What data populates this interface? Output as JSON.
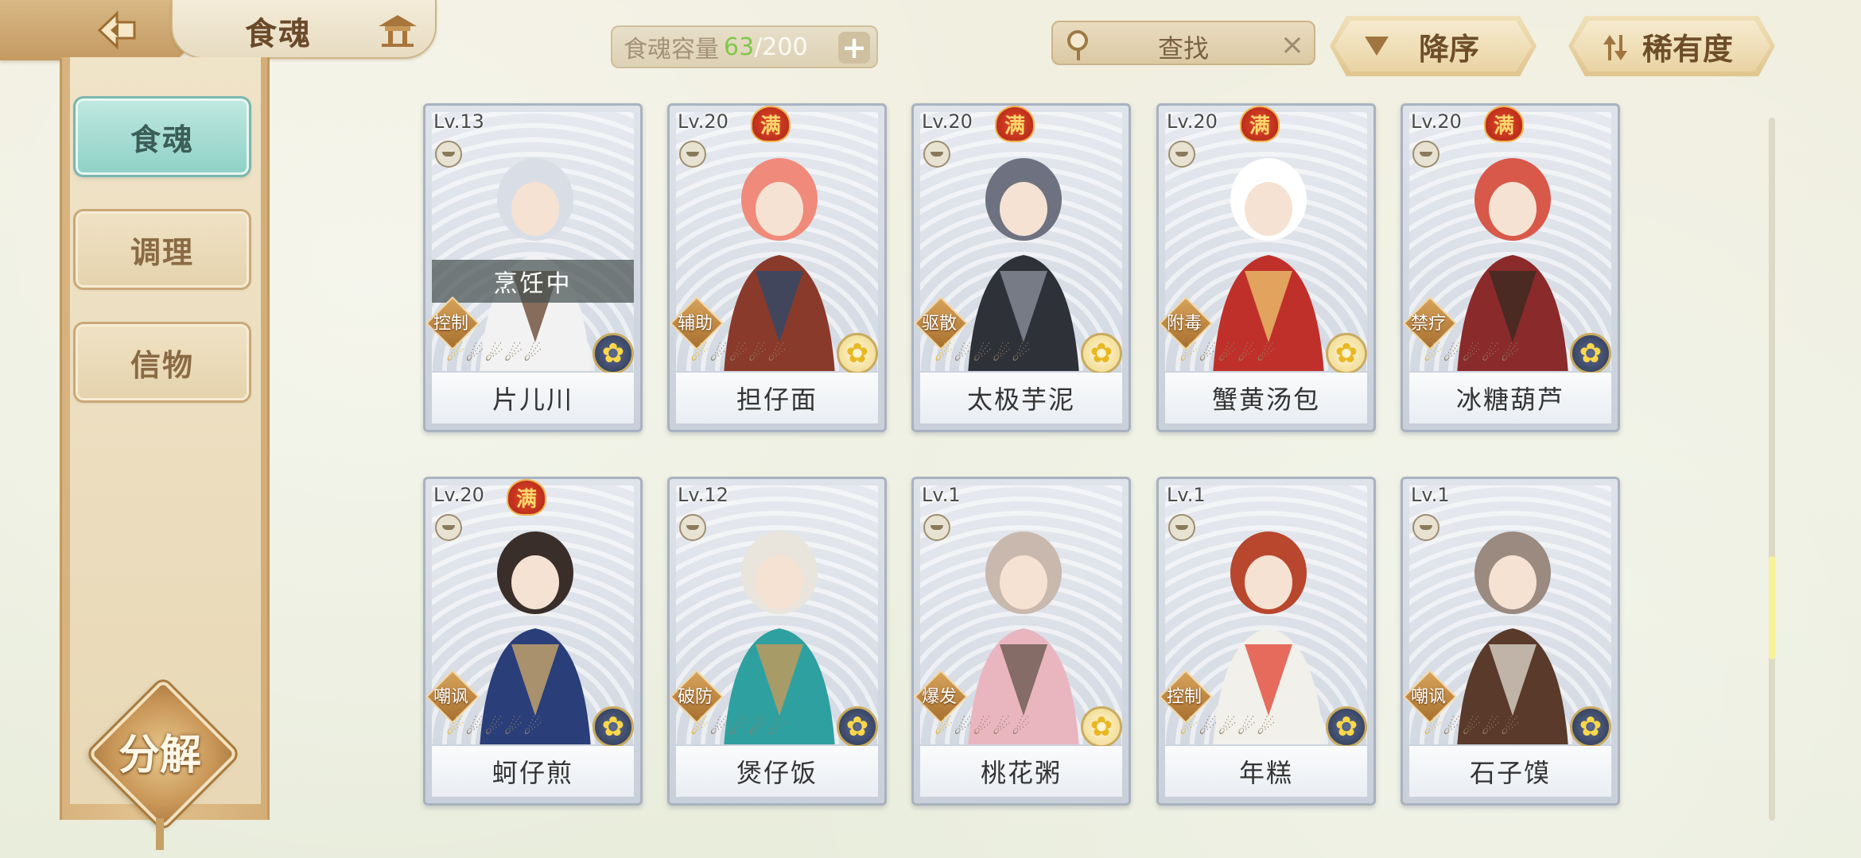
{
  "header": {
    "title": "食魂",
    "back": "back-arrow-icon",
    "home": "pavilion-icon"
  },
  "sidebar": {
    "tabs": [
      {
        "label": "食魂",
        "active": true
      },
      {
        "label": "调理",
        "active": false
      },
      {
        "label": "信物",
        "active": false
      }
    ],
    "decompose_label": "分解"
  },
  "capacity": {
    "label": "食魂容量",
    "current": "63",
    "max": "/200",
    "plus": "+"
  },
  "search": {
    "placeholder": "查找",
    "clear": "×"
  },
  "sort": {
    "order_label": "降序",
    "rarity_label": "稀有度"
  },
  "cards": [
    {
      "level": "Lv.13",
      "full": "",
      "role": "控制",
      "stars": 1,
      "element": "dark",
      "name": "片儿川",
      "status": "烹饪中"
    },
    {
      "level": "Lv.20",
      "full": "满",
      "role": "辅助",
      "stars": 1,
      "element": "gold",
      "name": "担仔面",
      "status": ""
    },
    {
      "level": "Lv.20",
      "full": "满",
      "role": "驱散",
      "stars": 1,
      "element": "gold",
      "name": "太极芋泥",
      "status": ""
    },
    {
      "level": "Lv.20",
      "full": "满",
      "role": "附毒",
      "stars": 1,
      "element": "gold",
      "name": "蟹黄汤包",
      "status": ""
    },
    {
      "level": "Lv.20",
      "full": "满",
      "role": "禁疗",
      "stars": 1,
      "element": "dark",
      "name": "冰糖葫芦",
      "status": ""
    },
    {
      "level": "Lv.20",
      "full": "满",
      "role": "嘲讽",
      "stars": 1,
      "element": "dark",
      "name": "蚵仔煎",
      "status": ""
    },
    {
      "level": "Lv.12",
      "full": "",
      "role": "破防",
      "stars": 1,
      "element": "dark",
      "name": "煲仔饭",
      "status": ""
    },
    {
      "level": "Lv.1",
      "full": "",
      "role": "爆发",
      "stars": 1,
      "element": "gold",
      "name": "桃花粥",
      "status": ""
    },
    {
      "level": "Lv.1",
      "full": "",
      "role": "控制",
      "stars": 1,
      "element": "dark",
      "name": "年糕",
      "status": ""
    },
    {
      "level": "Lv.1",
      "full": "",
      "role": "嘲讽",
      "stars": 1,
      "element": "dark",
      "name": "石子馍",
      "status": ""
    }
  ],
  "colors": {
    "accent_teal": "#8fd1c6",
    "gold": "#e7b52f",
    "full_badge": "#c0301c"
  }
}
